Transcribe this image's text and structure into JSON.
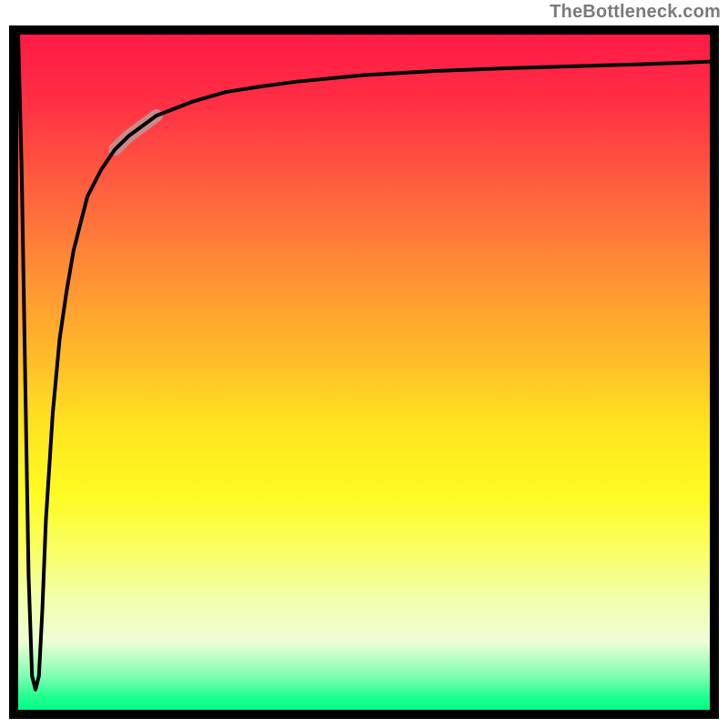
{
  "attribution": "TheBottleneck.com",
  "chart_data": {
    "type": "line",
    "title": "",
    "xlabel": "",
    "ylabel": "",
    "xlim": [
      0,
      100
    ],
    "ylim": [
      0,
      100
    ],
    "gradient_stops": [
      {
        "pct": 0,
        "color": "#ff1a47"
      },
      {
        "pct": 10,
        "color": "#ff2f44"
      },
      {
        "pct": 22,
        "color": "#ff5d3f"
      },
      {
        "pct": 34,
        "color": "#ff8a36"
      },
      {
        "pct": 46,
        "color": "#ffb52a"
      },
      {
        "pct": 58,
        "color": "#ffe41f"
      },
      {
        "pct": 68,
        "color": "#fffb22"
      },
      {
        "pct": 76,
        "color": "#f9ff5e"
      },
      {
        "pct": 83,
        "color": "#f3ffa8"
      },
      {
        "pct": 90,
        "color": "#ecffd6"
      },
      {
        "pct": 95,
        "color": "#7fffb0"
      },
      {
        "pct": 98,
        "color": "#21ff8f"
      },
      {
        "pct": 100,
        "color": "#00ff86"
      }
    ],
    "series": [
      {
        "name": "curve",
        "x": [
          0,
          0.5,
          1,
          1.5,
          2,
          2.5,
          3,
          3.5,
          4,
          5,
          6,
          7,
          8,
          9,
          10,
          12,
          14,
          16,
          20,
          25,
          30,
          35,
          40,
          50,
          60,
          70,
          80,
          90,
          100
        ],
        "y": [
          100,
          80,
          50,
          20,
          5,
          3,
          5,
          15,
          28,
          44,
          55,
          62,
          68,
          72,
          76,
          80,
          83,
          85,
          88,
          90,
          91.5,
          92.3,
          93,
          94,
          94.6,
          95,
          95.3,
          95.6,
          96
        ]
      }
    ],
    "highlight_segment": {
      "series": "curve",
      "x_start": 14,
      "x_end": 20,
      "color": "#c88a8a",
      "width": 14
    }
  }
}
